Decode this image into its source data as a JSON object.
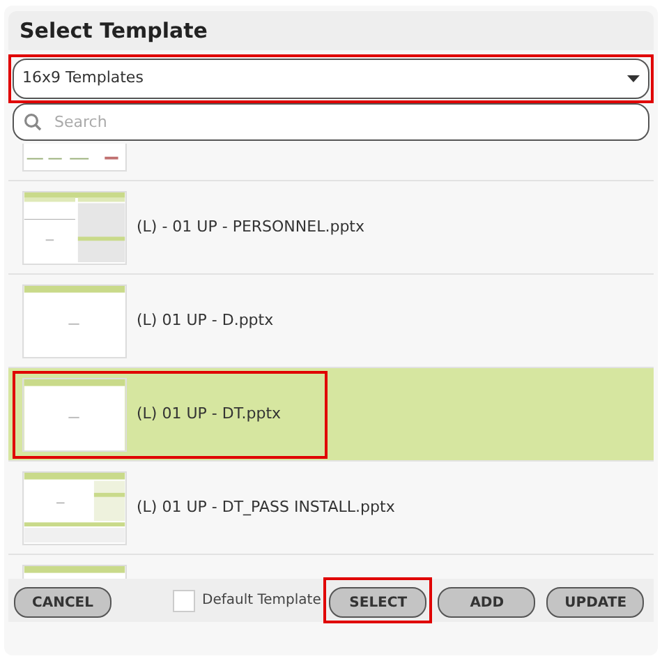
{
  "title": "Select Template",
  "template_set": {
    "value": "16x9 Templates",
    "highlighted": true
  },
  "search": {
    "placeholder": "Search"
  },
  "templates": [
    {
      "kind": "header-strip",
      "selected": false,
      "highlighted": false
    },
    {
      "kind": "table",
      "name": "(L) - 01 UP - PERSONNEL.pptx",
      "selected": false,
      "highlighted": false
    },
    {
      "kind": "blank",
      "name": "(L) 01 UP - D.pptx",
      "selected": false,
      "highlighted": false
    },
    {
      "kind": "blank",
      "name": "(L) 01 UP - DT.pptx",
      "selected": true,
      "highlighted": true
    },
    {
      "kind": "pass",
      "name": "(L) 01 UP - DT_PASS INSTALL.pptx",
      "selected": false,
      "highlighted": false
    },
    {
      "kind": "blank",
      "selected": false,
      "highlighted": false
    }
  ],
  "default_template": {
    "label": "Default Template",
    "checked": false
  },
  "buttons": [
    {
      "label": "CANCEL",
      "highlighted": false
    },
    {
      "label": "SELECT",
      "highlighted": true
    },
    {
      "label": "ADD",
      "highlighted": false
    },
    {
      "label": "UPDATE",
      "highlighted": false
    }
  ]
}
